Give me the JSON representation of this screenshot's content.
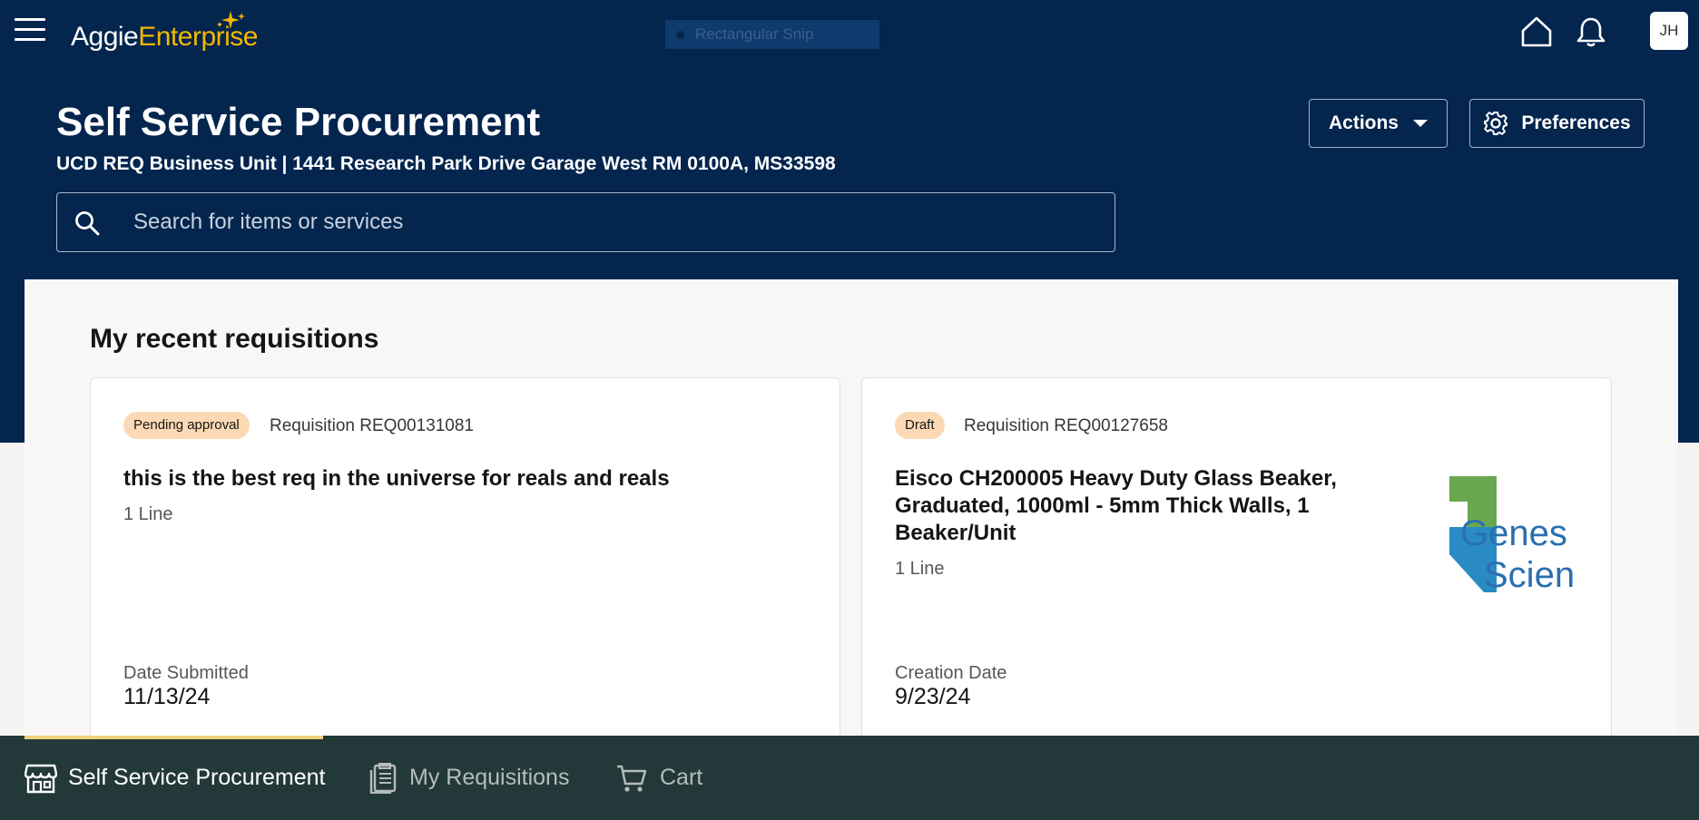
{
  "topbar": {
    "logo_part1": "Aggie",
    "logo_part2": "Enterprise",
    "snip_label": "Rectangular Snip",
    "home_icon": "home-icon",
    "bell_icon": "bell-icon",
    "avatar_initials": "JH"
  },
  "header": {
    "title": "Self Service Procurement",
    "subtitle": "UCD REQ Business Unit | 1441 Research Park Drive Garage West RM 0100A, MS33598",
    "actions_label": "Actions",
    "preferences_label": "Preferences"
  },
  "search": {
    "placeholder": "Search for items or services",
    "value": ""
  },
  "recent": {
    "title": "My recent requisitions",
    "cards": [
      {
        "status": "Pending approval",
        "requisition": "Requisition REQ00131081",
        "title": "this is the best req in the universe for reals and reals",
        "lines": "1 Line",
        "date_label": "Date Submitted",
        "date_value": "11/13/24"
      },
      {
        "status": "Draft",
        "requisition": "Requisition REQ00127658",
        "title": "Eisco CH200005 Heavy Duty Glass Beaker, Graduated, 1000ml - 5mm Thick Walls, 1 Beaker/Unit",
        "lines": "1 Line",
        "date_label": "Creation Date",
        "date_value": "9/23/24",
        "thumbnail_text_top": "Genes",
        "thumbnail_text_bottom": "Scien"
      }
    ]
  },
  "bottom_nav": {
    "items": [
      {
        "label": "Self Service Procurement",
        "icon": "store-icon",
        "active": true
      },
      {
        "label": "My Requisitions",
        "icon": "clipboard-list-icon",
        "active": false
      },
      {
        "label": "Cart",
        "icon": "cart-icon",
        "active": false
      }
    ]
  },
  "colors": {
    "header_bg": "#03254e",
    "logo_accent": "#f5b700",
    "badge_bg": "#fbd9b5",
    "bottom_nav_bg": "#233939",
    "active_indicator": "#f2d07a"
  }
}
